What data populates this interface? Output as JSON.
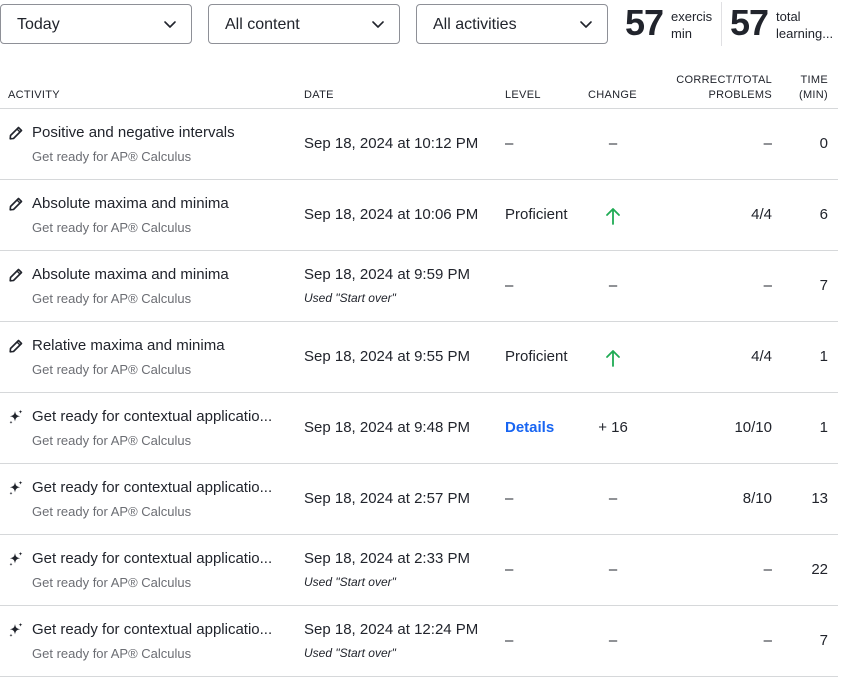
{
  "filters": {
    "date": "Today",
    "content": "All content",
    "activity": "All activities"
  },
  "stats": {
    "exercise_value": "57",
    "exercise_label_line1": "exercis",
    "exercise_label_line2": "min",
    "total_value": "57",
    "total_label_line1": "total",
    "total_label_line2": "learning..."
  },
  "table": {
    "headers": {
      "activity": "ACTIVITY",
      "date": "DATE",
      "level": "LEVEL",
      "change": "CHANGE",
      "correct_line1": "CORRECT/TOTAL",
      "correct_line2": "PROBLEMS",
      "time_line1": "TIME",
      "time_line2": "(MIN)"
    },
    "rows": [
      {
        "icon": "pencil-icon",
        "title": "Positive and negative intervals",
        "course": "Get ready for AP® Calculus",
        "date": "Sep 18, 2024 at 10:12 PM",
        "note": "",
        "level": "–",
        "change": "–",
        "correct": "–",
        "time": "0"
      },
      {
        "icon": "pencil-icon",
        "title": "Absolute maxima and minima",
        "course": "Get ready for AP® Calculus",
        "date": "Sep 18, 2024 at 10:06 PM",
        "note": "",
        "level": "Proficient",
        "change": "up-arrow",
        "correct": "4/4",
        "time": "6"
      },
      {
        "icon": "pencil-icon",
        "title": "Absolute maxima and minima",
        "course": "Get ready for AP® Calculus",
        "date": "Sep 18, 2024 at 9:59 PM",
        "note": "Used \"Start over\"",
        "level": "–",
        "change": "–",
        "correct": "–",
        "time": "7"
      },
      {
        "icon": "pencil-icon",
        "title": "Relative maxima and minima",
        "course": "Get ready for AP® Calculus",
        "date": "Sep 18, 2024 at 9:55 PM",
        "note": "",
        "level": "Proficient",
        "change": "up-arrow",
        "correct": "4/4",
        "time": "1"
      },
      {
        "icon": "sparkle-icon",
        "title": "Get ready for contextual applicatio...",
        "course": "Get ready for AP® Calculus",
        "date": "Sep 18, 2024 at 9:48 PM",
        "note": "",
        "level": "Details",
        "change": "+ 16",
        "correct": "10/10",
        "time": "1"
      },
      {
        "icon": "sparkle-icon",
        "title": "Get ready for contextual applicatio...",
        "course": "Get ready for AP® Calculus",
        "date": "Sep 18, 2024 at 2:57 PM",
        "note": "",
        "level": "–",
        "change": "–",
        "correct": "8/10",
        "time": "13"
      },
      {
        "icon": "sparkle-icon",
        "title": "Get ready for contextual applicatio...",
        "course": "Get ready for AP® Calculus",
        "date": "Sep 18, 2024 at 2:33 PM",
        "note": "Used \"Start over\"",
        "level": "–",
        "change": "–",
        "correct": "–",
        "time": "22"
      },
      {
        "icon": "sparkle-icon",
        "title": "Get ready for contextual applicatio...",
        "course": "Get ready for AP® Calculus",
        "date": "Sep 18, 2024 at 12:24 PM",
        "note": "Used \"Start over\"",
        "level": "–",
        "change": "–",
        "correct": "–",
        "time": "7"
      }
    ]
  },
  "colors": {
    "link": "#1865f2",
    "increase": "#1fab54",
    "text": "#21242c",
    "muted": "#6b6d73",
    "border": "#d6d8da"
  }
}
